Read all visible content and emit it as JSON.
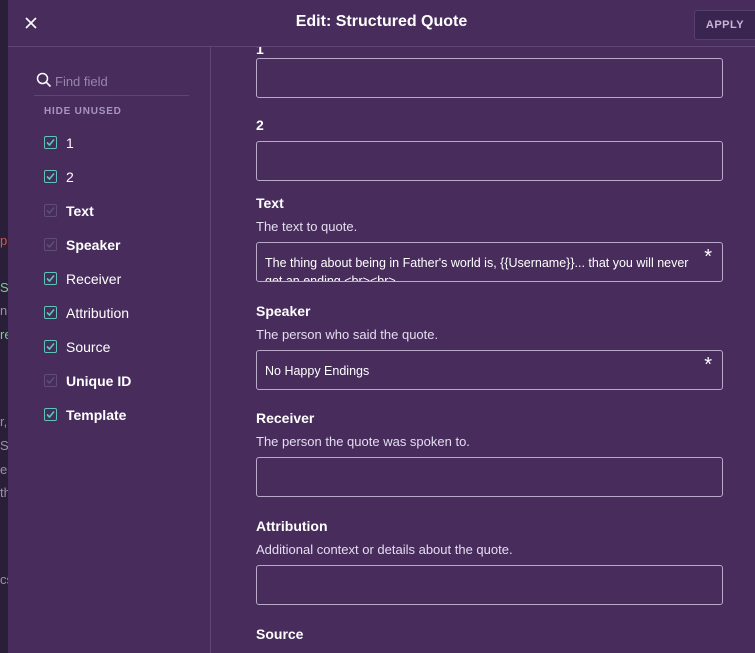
{
  "dialog": {
    "title": "Edit: Structured Quote",
    "apply_label": "APPLY",
    "close_icon": "close-icon"
  },
  "sidebar": {
    "search_placeholder": "Find field",
    "hide_unused_label": "HIDE UNUSED",
    "items": [
      {
        "label": "1",
        "checked": true,
        "bold": false
      },
      {
        "label": "2",
        "checked": true,
        "bold": false
      },
      {
        "label": "Text",
        "checked": false,
        "bold": true
      },
      {
        "label": "Speaker",
        "checked": false,
        "bold": true
      },
      {
        "label": "Receiver",
        "checked": true,
        "bold": false
      },
      {
        "label": "Attribution",
        "checked": true,
        "bold": false
      },
      {
        "label": "Source",
        "checked": true,
        "bold": false
      },
      {
        "label": "Unique ID",
        "checked": false,
        "bold": true
      },
      {
        "label": "Template",
        "checked": true,
        "bold": true
      }
    ]
  },
  "fields": {
    "f1": {
      "label": "1",
      "value": ""
    },
    "f2": {
      "label": "2",
      "value": ""
    },
    "text": {
      "label": "Text",
      "description": "The text to quote.",
      "value": "The thing about being in Father's world is, {{Username}}... that you will never get an ending <br><br>",
      "required_mark": "*"
    },
    "speaker": {
      "label": "Speaker",
      "description": "The person who said the quote.",
      "value": "No Happy Endings",
      "required_mark": "*"
    },
    "receiver": {
      "label": "Receiver",
      "description": "The person the quote was spoken to.",
      "value": ""
    },
    "attribution": {
      "label": "Attribution",
      "description": "Additional context or details about the quote.",
      "value": ""
    },
    "source": {
      "label": "Source"
    }
  },
  "background_page": {
    "fragments": [
      "p",
      "Sx",
      "n",
      "re",
      "r,",
      "S",
      "er",
      "th",
      "cs"
    ]
  },
  "colors": {
    "modal_bg": "#472c5c",
    "checkbox_checked": "#5fc4b8",
    "field_border": "#b9aac9"
  }
}
